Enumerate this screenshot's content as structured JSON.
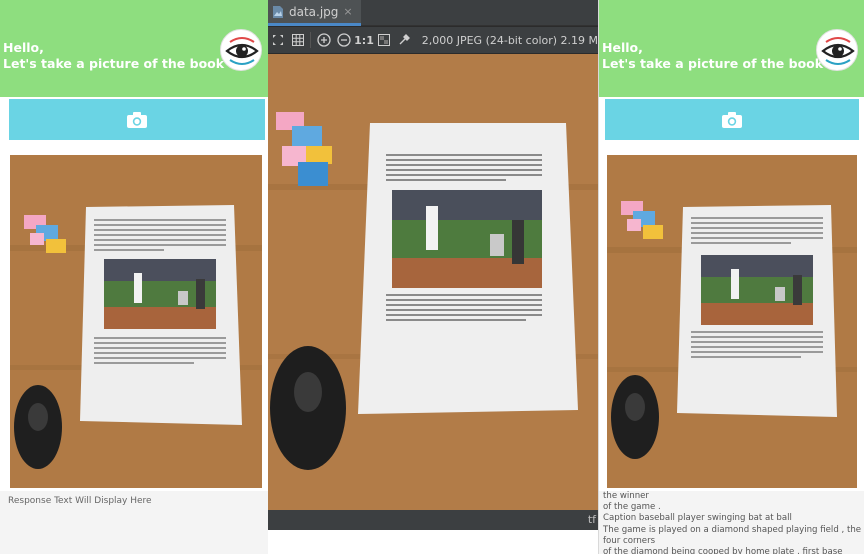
{
  "left_phone": {
    "greeting_line1": "Hello,",
    "greeting_line2": "Let's take a picture of the book",
    "avatar_icon": "eye-icon",
    "camera_icon": "camera-icon",
    "response_placeholder": "Response Text Will Display Here"
  },
  "viewer": {
    "tab_label": "data.jpg",
    "tab_close": "×",
    "zoom_actual_label": "1:1",
    "image_info": "2,000 JPEG (24-bit color) 2.19 M",
    "status_tail": "tf"
  },
  "right_phone": {
    "greeting_line1": "Hello,",
    "greeting_line2": "Let's take a picture of the book",
    "avatar_icon": "eye-icon",
    "camera_icon": "camera-icon",
    "response_lines": "the winner\nof the game .\nCaption baseball player swinging bat at ball\nThe game is played on a diamond shaped playing field , the four corners\nof the diamond being cooped by home plate , first base"
  },
  "colors": {
    "header_green": "#8ede7f",
    "camera_button_cyan": "#6ad4e4",
    "viewer_dark": "#2b2b2b",
    "tab_accent": "#4a88c7"
  }
}
